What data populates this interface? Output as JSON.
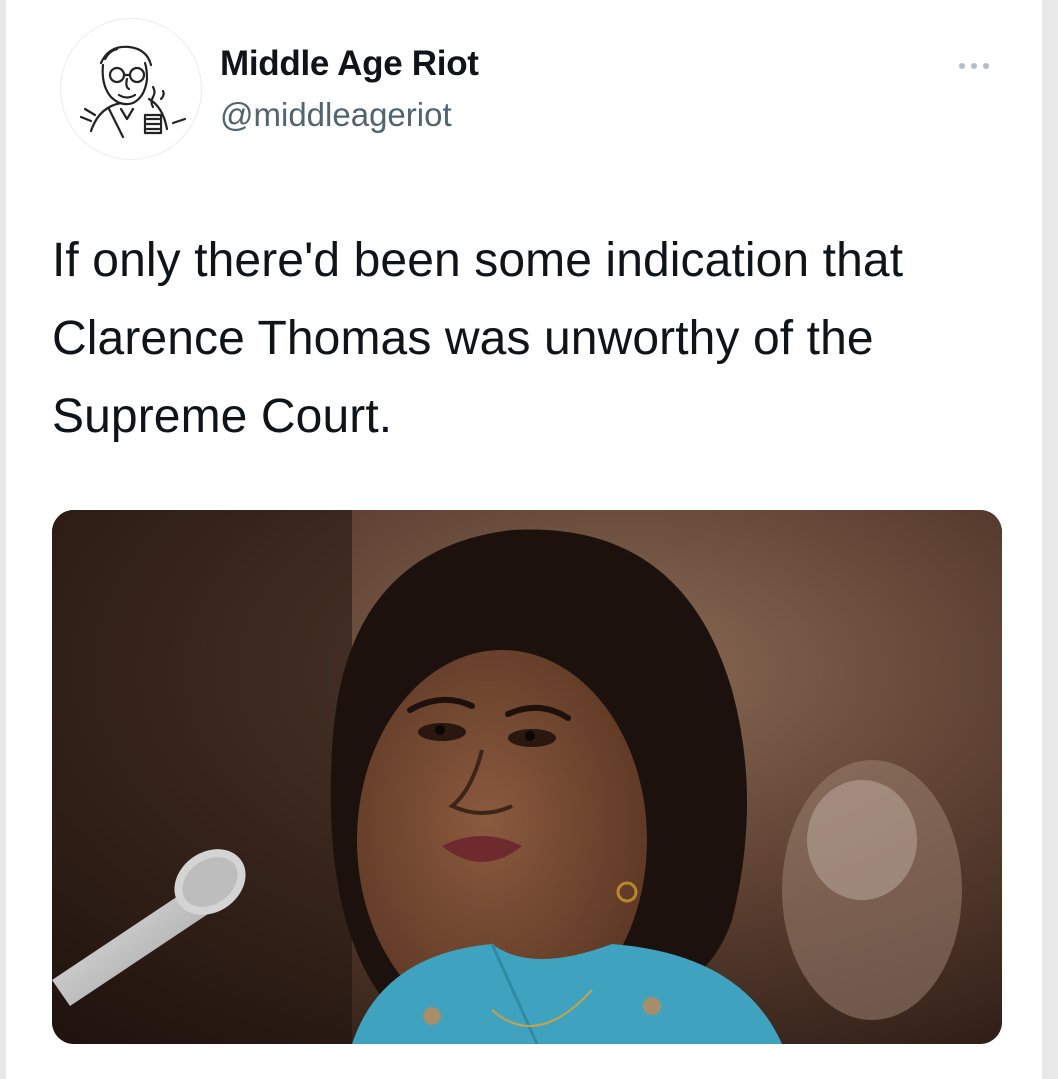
{
  "tweet": {
    "author": {
      "display_name": "Middle Age Riot",
      "handle": "@middleageriot",
      "avatar_icon": "cartoon-man-avatar-icon"
    },
    "more_icon": "more-options-icon",
    "text": "If only there'd been some indication that Clarence Thomas was unworthy of the Supreme Court.",
    "media": {
      "type": "photo"
    }
  },
  "colors": {
    "text_primary": "#0f1419",
    "text_secondary": "#536471",
    "card_background": "#ffffff",
    "page_background": "#e9e9ea",
    "shirt_teal": "#3fa3bf"
  }
}
